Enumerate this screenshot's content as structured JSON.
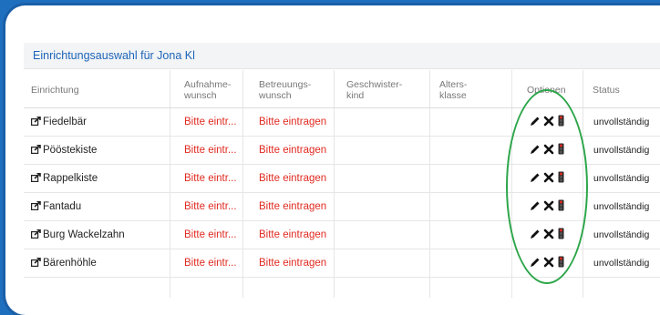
{
  "title": "Einrichtungsauswahl für Jona Kl",
  "columns": {
    "einrichtung": "Einrichtung",
    "aufnahme_1": "Aufnahme-",
    "aufnahme_2": "wunsch",
    "betreuung_1": "Betreuungs-",
    "betreuung_2": "wunsch",
    "geschwister_1": "Geschwister-",
    "geschwister_2": "kind",
    "alters_1": "Alters-",
    "alters_2": "klasse",
    "optionen": "Optionen",
    "status": "Status"
  },
  "rows": [
    {
      "name": "Fiedelbär",
      "aufnahme": "Bitte eintr...",
      "betreuung": "Bitte eintragen",
      "status": "unvollständig"
    },
    {
      "name": "Pööstekiste",
      "aufnahme": "Bitte eintr...",
      "betreuung": "Bitte eintragen",
      "status": "unvollständig"
    },
    {
      "name": "Rappelkiste",
      "aufnahme": "Bitte eintr...",
      "betreuung": "Bitte eintragen",
      "status": "unvollständig"
    },
    {
      "name": "Fantadu",
      "aufnahme": "Bitte eintr...",
      "betreuung": "Bitte eintragen",
      "status": "unvollständig"
    },
    {
      "name": "Burg Wackelzahn",
      "aufnahme": "Bitte eintr...",
      "betreuung": "Bitte eintragen",
      "status": "unvollständig"
    },
    {
      "name": "Bärenhöhle",
      "aufnahme": "Bitte eintr...",
      "betreuung": "Bitte eintragen",
      "status": "unvollständig"
    }
  ],
  "icons": {
    "row_link": "external-link-icon",
    "edit": "pencil-icon",
    "delete": "close-icon",
    "priority": "traffic-light-icon"
  },
  "colors": {
    "frame_blue": "#1f6fbf",
    "title_blue": "#1d64b8",
    "required_red": "#e02a20",
    "highlight_green": "#2da64a"
  }
}
